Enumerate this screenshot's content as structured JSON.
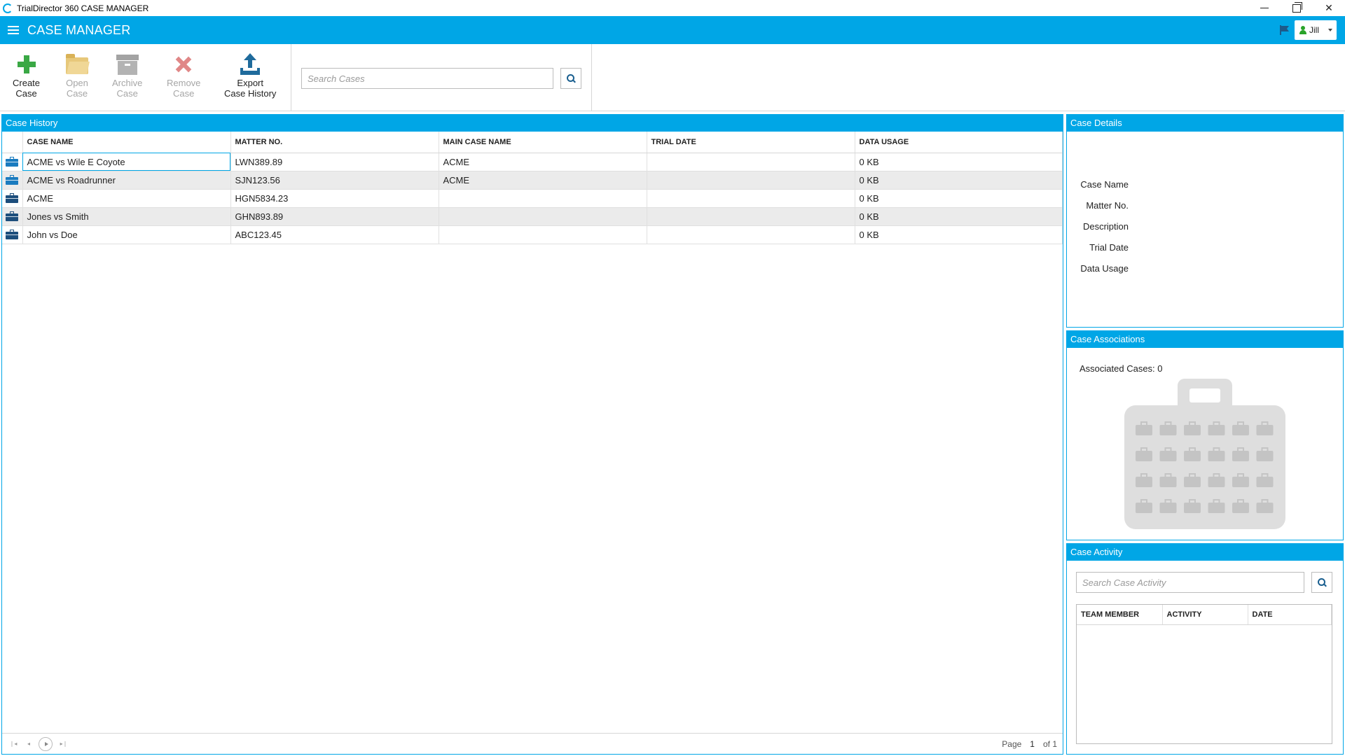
{
  "window": {
    "title": "TrialDirector 360 CASE MANAGER"
  },
  "header": {
    "title": "CASE MANAGER",
    "user": "Jill"
  },
  "toolbar": {
    "create": [
      "Create",
      "Case"
    ],
    "open": [
      "Open",
      "Case"
    ],
    "archive": [
      "Archive",
      "Case"
    ],
    "remove": [
      "Remove",
      "Case"
    ],
    "export": [
      "Export",
      "Case History"
    ],
    "search_placeholder": "Search Cases"
  },
  "case_history": {
    "title": "Case History",
    "columns": [
      "CASE NAME",
      "MATTER NO.",
      "MAIN CASE NAME",
      "TRIAL DATE",
      "DATA USAGE"
    ],
    "rows": [
      {
        "name": "ACME vs Wile E Coyote",
        "matter": "LWN389.89",
        "main": "ACME",
        "trial": "",
        "usage": "0 KB"
      },
      {
        "name": "ACME vs Roadrunner",
        "matter": "SJN123.56",
        "main": "ACME",
        "trial": "",
        "usage": "0 KB"
      },
      {
        "name": "ACME",
        "matter": "HGN5834.23",
        "main": "",
        "trial": "",
        "usage": "0 KB"
      },
      {
        "name": "Jones vs Smith",
        "matter": "GHN893.89",
        "main": "",
        "trial": "",
        "usage": "0 KB"
      },
      {
        "name": "John vs Doe",
        "matter": "ABC123.45",
        "main": "",
        "trial": "",
        "usage": "0 KB"
      }
    ],
    "pager": {
      "page_label": "Page",
      "page": "1",
      "of_label": "of 1"
    }
  },
  "case_details": {
    "title": "Case Details",
    "labels": [
      "Case Name",
      "Matter No.",
      "Description",
      "Trial Date",
      "Data Usage"
    ]
  },
  "case_associations": {
    "title": "Case Associations",
    "count_label": "Associated Cases: 0"
  },
  "case_activity": {
    "title": "Case Activity",
    "search_placeholder": "Search Case Activity",
    "columns": [
      "TEAM MEMBER",
      "ACTIVITY",
      "DATE"
    ]
  },
  "colors": {
    "accent": "#00a6e6",
    "header_text": "#ffffff",
    "create": "#3aa845",
    "remove": "#e08787",
    "export": "#1f6b9c"
  }
}
